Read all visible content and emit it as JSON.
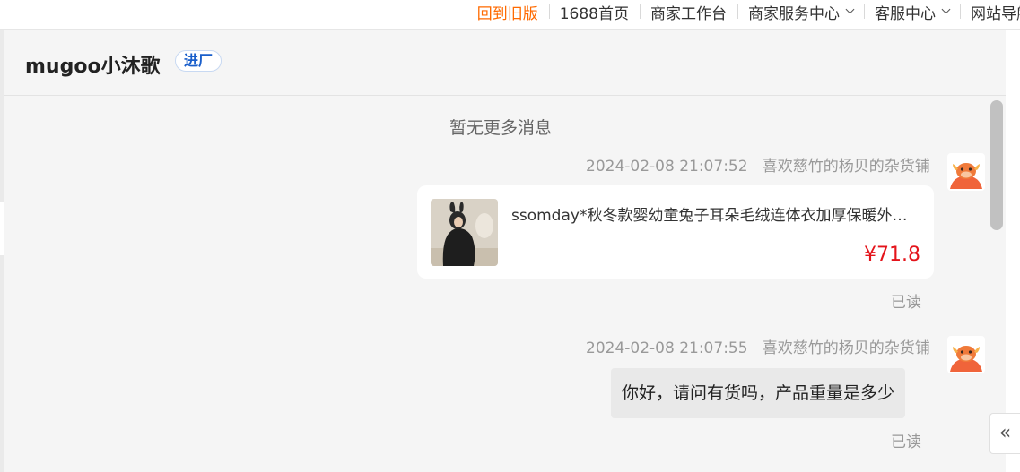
{
  "topnav": {
    "items": [
      {
        "label": "回到旧版",
        "active": true,
        "dropdown": false
      },
      {
        "label": "1688首页",
        "active": false,
        "dropdown": false
      },
      {
        "label": "商家工作台",
        "active": false,
        "dropdown": false
      },
      {
        "label": "商家服务中心",
        "active": false,
        "dropdown": true
      },
      {
        "label": "客服中心",
        "active": false,
        "dropdown": true
      },
      {
        "label": "网站导航",
        "active": false,
        "dropdown": true
      }
    ]
  },
  "chat": {
    "shop_name": "mugoo小沐歌",
    "tag": "进厂",
    "no_more": "暂无更多消息",
    "messages": [
      {
        "time": "2024-02-08 21:07:52",
        "sender": "喜欢慈竹的杨贝的杂货铺",
        "type": "product",
        "product_title": "ssomday*秋冬款婴幼童兔子耳朵毛绒连体衣加厚保暖外…",
        "product_price": "¥71.8",
        "status": "已读"
      },
      {
        "time": "2024-02-08 21:07:55",
        "sender": "喜欢慈竹的杨贝的杂货铺",
        "type": "text",
        "text": "你好，请问有货吗，产品重量是多少",
        "status": "已读"
      }
    ]
  },
  "collapse_icon": "«",
  "colors": {
    "accent": "#ff6a00",
    "price": "#e4141b",
    "tag": "#1a5fcb",
    "panel": "#f5f5f5"
  }
}
